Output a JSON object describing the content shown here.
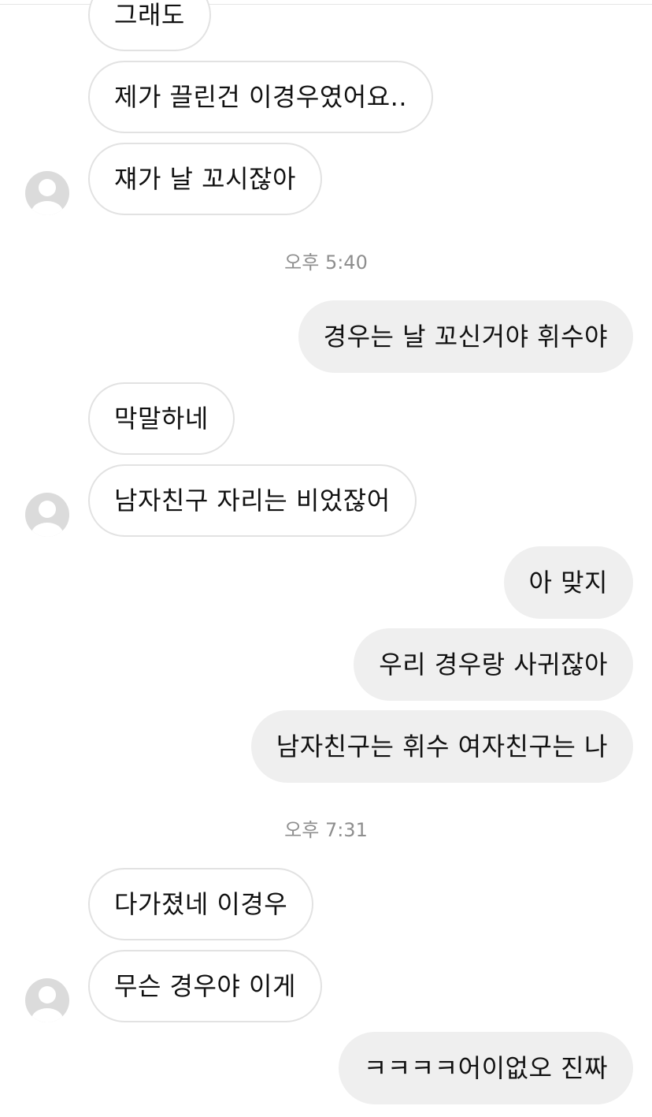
{
  "chat": {
    "messages": [
      {
        "text": "그래도",
        "side": "incoming"
      },
      {
        "text": "제가 끌린건 이경우였어요..",
        "side": "incoming"
      },
      {
        "text": "쟤가 날 꼬시잖아",
        "side": "incoming",
        "has_avatar": true
      },
      {
        "text": "경우는 날 꼬신거야 휘수야",
        "side": "outgoing"
      },
      {
        "text": "막말하네",
        "side": "incoming"
      },
      {
        "text": "남자친구 자리는 비었잖어",
        "side": "incoming",
        "has_avatar": true
      },
      {
        "text": "아 맞지",
        "side": "outgoing"
      },
      {
        "text": "우리 경우랑 사귀잖아",
        "side": "outgoing"
      },
      {
        "text": "남자친구는 휘수 여자친구는 나",
        "side": "outgoing"
      },
      {
        "text": "다가졌네 이경우",
        "side": "incoming"
      },
      {
        "text": "무슨 경우야 이게",
        "side": "incoming",
        "has_avatar": true
      },
      {
        "text": "ㅋㅋㅋㅋ어이없오 진짜",
        "side": "outgoing"
      }
    ],
    "timestamps": [
      {
        "text": "오후 5:40"
      },
      {
        "text": "오후 7:31"
      }
    ],
    "avatar_icon": "default-user-icon",
    "colors": {
      "outgoing_bubble": "#efefef",
      "incoming_border": "#e2e2e2",
      "timestamp": "#8e8e8e",
      "avatar_bg": "#dbdbdb"
    }
  }
}
